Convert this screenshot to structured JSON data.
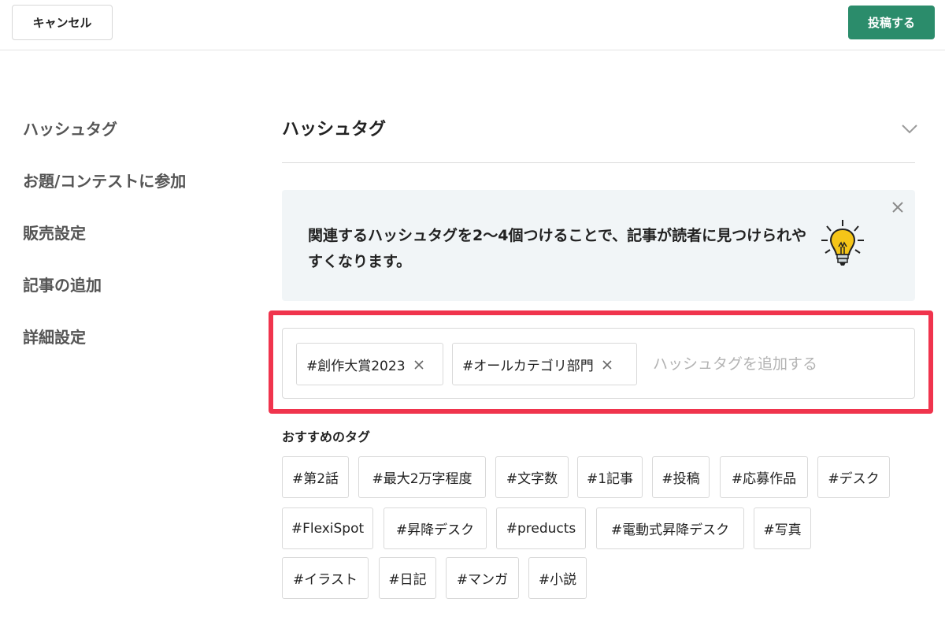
{
  "header": {
    "cancel_label": "キャンセル",
    "post_label": "投稿する"
  },
  "sidebar": {
    "items": [
      {
        "label": "ハッシュタグ"
      },
      {
        "label": "お題/コンテストに参加"
      },
      {
        "label": "販売設定"
      },
      {
        "label": "記事の追加"
      },
      {
        "label": "詳細設定"
      }
    ]
  },
  "section": {
    "title": "ハッシュタグ",
    "toggle_icon": "chevron-down-icon"
  },
  "tip": {
    "text": "関連するハッシュタグを2〜4個つけることで、記事が読者に見つけられやすくなります。",
    "close_icon": "close-icon",
    "illustration_icon": "lightbulb-icon"
  },
  "tag_input": {
    "selected_tags": [
      "#創作大賞2023",
      "#オールカテゴリ部門"
    ],
    "placeholder": "ハッシュタグを追加する",
    "value": ""
  },
  "recommended": {
    "title": "おすすめのタグ",
    "tags": [
      "#第2話",
      "#最大2万字程度",
      "#文字数",
      "#1記事",
      "#投稿",
      "#応募作品",
      "#デスク",
      "#FlexiSpot",
      "#昇降デスク",
      "#preducts",
      "#電動式昇降デスク",
      "#写真",
      "#イラスト",
      "#日記",
      "#マンガ",
      "#小説"
    ]
  },
  "colors": {
    "accent": "#2b8c6b",
    "highlight": "#f0344d",
    "tip_background": "#f1f5f7",
    "bulb_yellow": "#f5c518"
  }
}
